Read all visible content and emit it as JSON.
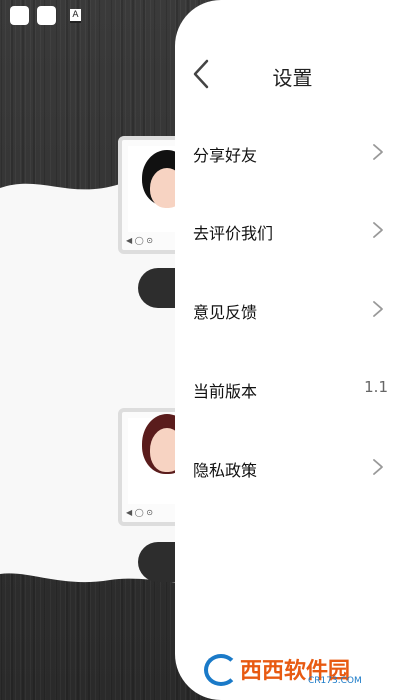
{
  "drawer": {
    "title": "设置",
    "menu": [
      {
        "label": "分享好友",
        "chevron": true
      },
      {
        "label": "去评价我们",
        "chevron": true
      },
      {
        "label": "意见反馈",
        "chevron": true
      },
      {
        "label": "当前版本",
        "value": "1.1"
      },
      {
        "label": "隐私政策",
        "chevron": true
      }
    ]
  },
  "icons": {
    "back": "chevron-left-icon",
    "item": "chevron-right-icon"
  },
  "watermark": {
    "brand": "西西软件园",
    "domain": "CR173.COM"
  },
  "status_bar": {
    "indicator": "A"
  },
  "colors": {
    "drawer_bg": "#ffffff",
    "background": "#2b2b2b",
    "chevron": "#999999",
    "watermark_orange": "#e85a12",
    "watermark_blue": "#1a7ac8"
  }
}
